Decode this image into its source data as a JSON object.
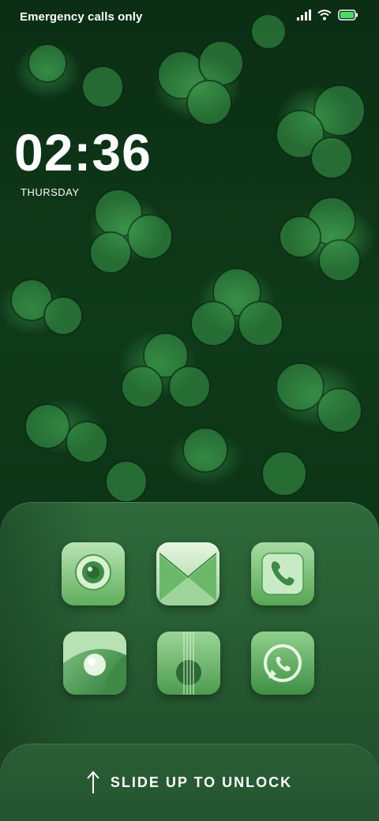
{
  "status_bar": {
    "carrier": "Emergency calls only",
    "icons": [
      "signal-icon",
      "wifi-icon",
      "battery-icon"
    ],
    "battery_color": "#4cd964"
  },
  "lockscreen": {
    "time": "02:36",
    "day": "THURSDAY"
  },
  "apps": [
    {
      "name": "camera-app",
      "icon": "camera-icon"
    },
    {
      "name": "messages-app",
      "icon": "envelope-icon"
    },
    {
      "name": "phone-app",
      "icon": "phone-icon"
    },
    {
      "name": "gallery-app",
      "icon": "gallery-icon"
    },
    {
      "name": "music-app",
      "icon": "guitar-icon"
    },
    {
      "name": "whatsapp-app",
      "icon": "whatsapp-icon"
    }
  ],
  "unlock": {
    "label": "SLIDE UP TO UNLOCK",
    "icon": "arrow-up-icon"
  },
  "colors": {
    "accent": "#3fa055",
    "icon_light": "#c8ebc6",
    "icon_dark": "#2e7a3e"
  }
}
